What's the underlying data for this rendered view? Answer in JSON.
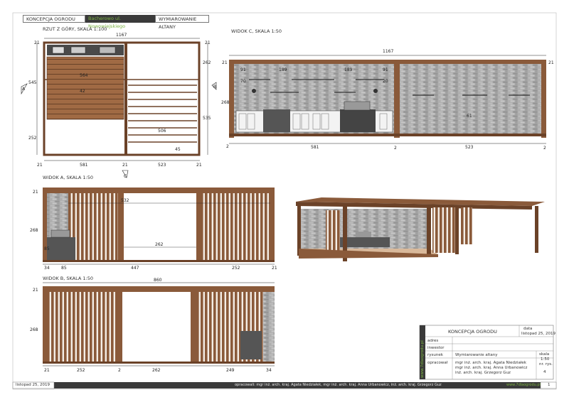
{
  "header": {
    "project": "KONCEPCJA OGRODU",
    "location": "Bacherowo ul. Nowowiejskiego",
    "sheet_title": "WYMIAROWANIE ALTANY"
  },
  "views": {
    "plan": {
      "title": "RZUT Z GÓRY, SKALA 1:100"
    },
    "view_c": {
      "title": "WIDOK C, SKALA 1:50"
    },
    "view_a": {
      "title": "WIDOK A, SKALA 1:50"
    },
    "view_b": {
      "title": "WIDOK B, SKALA 1:50"
    }
  },
  "section_marks": {
    "a": "A",
    "b": "B",
    "c": "C"
  },
  "dimensions": {
    "plan": [
      "1167",
      "21",
      "21",
      "262",
      "545",
      "564",
      "42",
      "252",
      "535",
      "506",
      "45",
      "581",
      "523",
      "21",
      "21",
      "21"
    ],
    "view_c": [
      "1167",
      "21",
      "21",
      "91",
      "189",
      "189",
      "91",
      "70",
      "20",
      "268",
      "61",
      "2",
      "581",
      "523",
      "2",
      "2"
    ],
    "view_a": [
      "21",
      "532",
      "268",
      "85",
      "262",
      "34",
      "85",
      "447",
      "252",
      "21"
    ],
    "view_b": [
      "860",
      "21",
      "268",
      "21",
      "252",
      "262",
      "249",
      "34",
      "2"
    ]
  },
  "title_block": {
    "project": "KONCEPCJA OGRODU",
    "date_label": "data",
    "date": "listopad 25, 2019",
    "address_label": "adres",
    "investor_label": "inwestor",
    "drawing_label": "rysunek",
    "drawing": "Wymiarowanie altany",
    "scale_label": "skala",
    "scale": "1:50",
    "author_label": "opracował",
    "authors": [
      "mgr inż. arch. kraj. Agata Niedziałek",
      "mgr inż. arch. kraj. Anna Urbanowicz",
      "inż. arch. kraj. Grzegorz Guz"
    ],
    "sheet_label": "nr. rys.",
    "sheet_no": "4",
    "logo_text": "www.7dlaogrodu.pl"
  },
  "footer": {
    "date": "listopad 25, 2019",
    "credits": "opracowali: mgr inż. arch. kraj. Agata Niedziałek, mgr inż. arch. kraj. Anna Urbanowicz, inż. arch. kraj. Grzegorz Guz",
    "website": "www.7dlaogrodu.pl",
    "page": "1"
  },
  "colors": {
    "wood": "#8a5a3a",
    "wood_dark": "#6b4228",
    "stone": "#a8a8a8",
    "accent_green": "#7cb342",
    "dark_band": "#3a3a3a"
  }
}
